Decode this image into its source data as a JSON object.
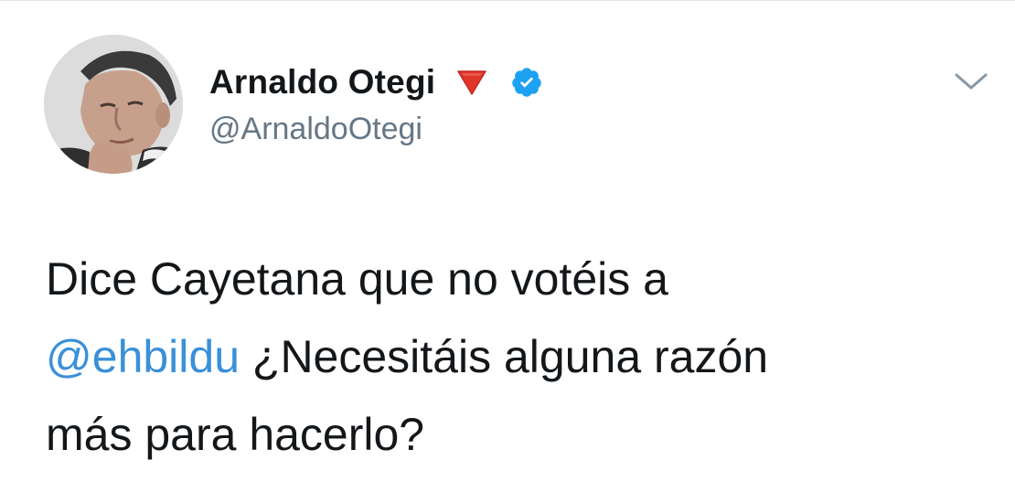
{
  "tweet": {
    "author": {
      "display_name": "Arnaldo Otegi",
      "handle": "@ArnaldoOtegi",
      "verified": true,
      "name_emoji_icon": "red-down-triangle-icon",
      "verified_icon": "verified-badge-icon"
    },
    "menu_icon": "chevron-down-icon",
    "text": {
      "line1": "Dice Cayetana que no votéis a",
      "mention": "@ehbildu",
      "line2_rest": " ¿Necesitáis alguna razón",
      "line3": "más para hacerlo?"
    }
  },
  "colors": {
    "text": "#14171a",
    "secondary": "#657786",
    "link": "#3a90d9",
    "verified": "#1da1f2",
    "flag_red": "#e0352b"
  }
}
